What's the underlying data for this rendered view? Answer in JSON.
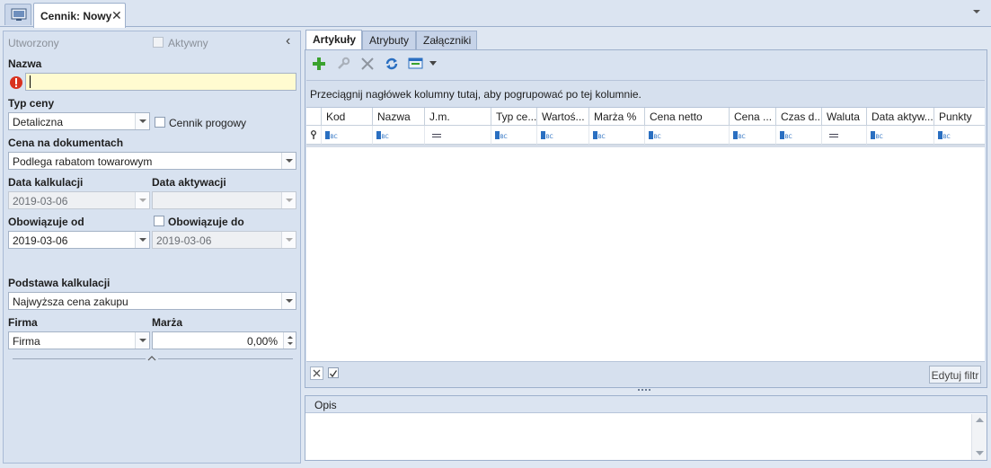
{
  "window": {
    "tab_title": "Cennik: Nowy",
    "close_glyph": "✕"
  },
  "left": {
    "created_label": "Utworzony",
    "active_label": "Aktywny",
    "name_label": "Nazwa",
    "name_value": "",
    "price_type_label": "Typ ceny",
    "price_type_value": "Detaliczna",
    "tier_label": "Cennik progowy",
    "doc_price_label": "Cena na dokumentach",
    "doc_price_value": "Podlega rabatom towarowym",
    "calc_date_label": "Data kalkulacji",
    "calc_date_value": "2019-03-06",
    "activation_date_label": "Data aktywacji",
    "activation_date_value": "",
    "valid_from_label": "Obowiązuje od",
    "valid_from_value": "2019-03-06",
    "valid_to_label": "Obowiązuje do",
    "valid_to_value": "2019-03-06",
    "calc_basis_label": "Podstawa kalkulacji",
    "calc_basis_value": "Najwyższa cena zakupu",
    "company_label": "Firma",
    "company_value": "Firma",
    "margin_label": "Marża",
    "margin_value": "0,00%",
    "collapse_glyph": "‹"
  },
  "tabs": [
    {
      "label": "Artykuły",
      "active": true
    },
    {
      "label": "Atrybuty",
      "active": false
    },
    {
      "label": "Załączniki",
      "active": false
    }
  ],
  "toolbar": {
    "icons": [
      "add-icon",
      "wrench-icon",
      "delete-icon",
      "refresh-icon",
      "export-icon"
    ]
  },
  "grid": {
    "group_hint": "Przeciągnij nagłówek kolumny tutaj, aby pogrupować po tej kolumnie.",
    "columns": [
      "Kod",
      "Nazwa",
      "J.m.",
      "Typ ce...",
      "Wartoś...",
      "Marża %",
      "Cena netto",
      "Cena ...",
      "Czas d...",
      "Waluta",
      "Data aktyw...",
      "Punkty"
    ],
    "filter_types": [
      "abc",
      "abc",
      "eq",
      "abc",
      "abc",
      "abc",
      "abc",
      "abc",
      "abc",
      "eq",
      "abc",
      "abc"
    ],
    "edit_filter_label": "Edytuj filtr"
  },
  "opis": {
    "label": "Opis",
    "value": ""
  },
  "colors": {
    "accent_green": "#3aa22e",
    "warning_red": "#d8321f",
    "name_field_bg": "#fffbd0"
  }
}
